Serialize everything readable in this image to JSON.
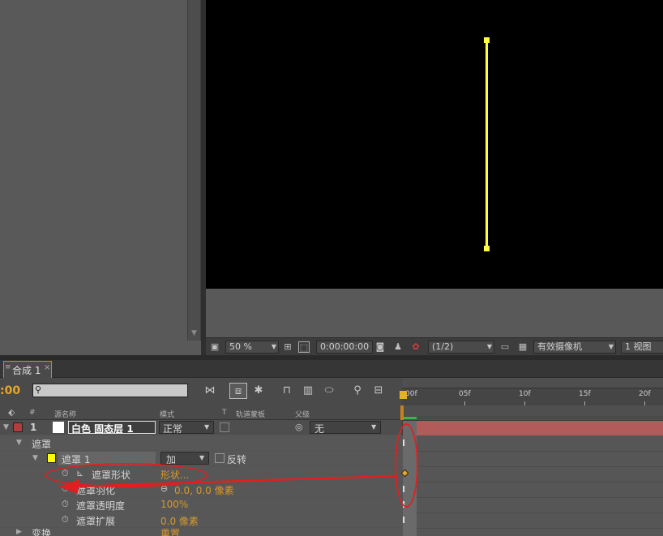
{
  "viewer_toolbar": {
    "zoom": "50 %",
    "timecode": "0:00:00:00",
    "resolution": "(1/2)",
    "camera": "有效摄像机",
    "views": "1 视图"
  },
  "tab": {
    "label": "合成 1",
    "close": "×",
    "mark": "≡"
  },
  "timeline": {
    "timecode": ":00",
    "search_icon": "⚲",
    "columns": {
      "number": "#",
      "source_name": "源名称",
      "mode": "模式",
      "t": "T",
      "track_matte": "轨道蒙板",
      "parent": "父级"
    },
    "ruler_labels": [
      "00f",
      "05f",
      "10f",
      "15f",
      "20f"
    ]
  },
  "layers": {
    "layer1": {
      "number": "1",
      "name": "白色 固态层 1",
      "mode": "正常",
      "parent": "无"
    },
    "masks_group": "遮罩",
    "mask1": {
      "name": "遮罩 1",
      "mode": "加",
      "invert_label": "反转"
    },
    "mask_path": {
      "label": "遮罩形状",
      "value": "形状..."
    },
    "mask_feather": {
      "label": "遮罩羽化",
      "value": "0.0, 0.0 像素"
    },
    "mask_opacity": {
      "label": "遮罩透明度",
      "value": "100%"
    },
    "mask_expansion": {
      "label": "遮罩扩展",
      "value": "0.0 像素"
    },
    "transform": {
      "label": "变换",
      "value": "重置"
    }
  },
  "colors": {
    "mask_line": "#ffff3a",
    "layer_label": "#b33c3c",
    "mask_label": "#ffff00",
    "accent": "#d8982a",
    "annotation": "#e02020"
  }
}
